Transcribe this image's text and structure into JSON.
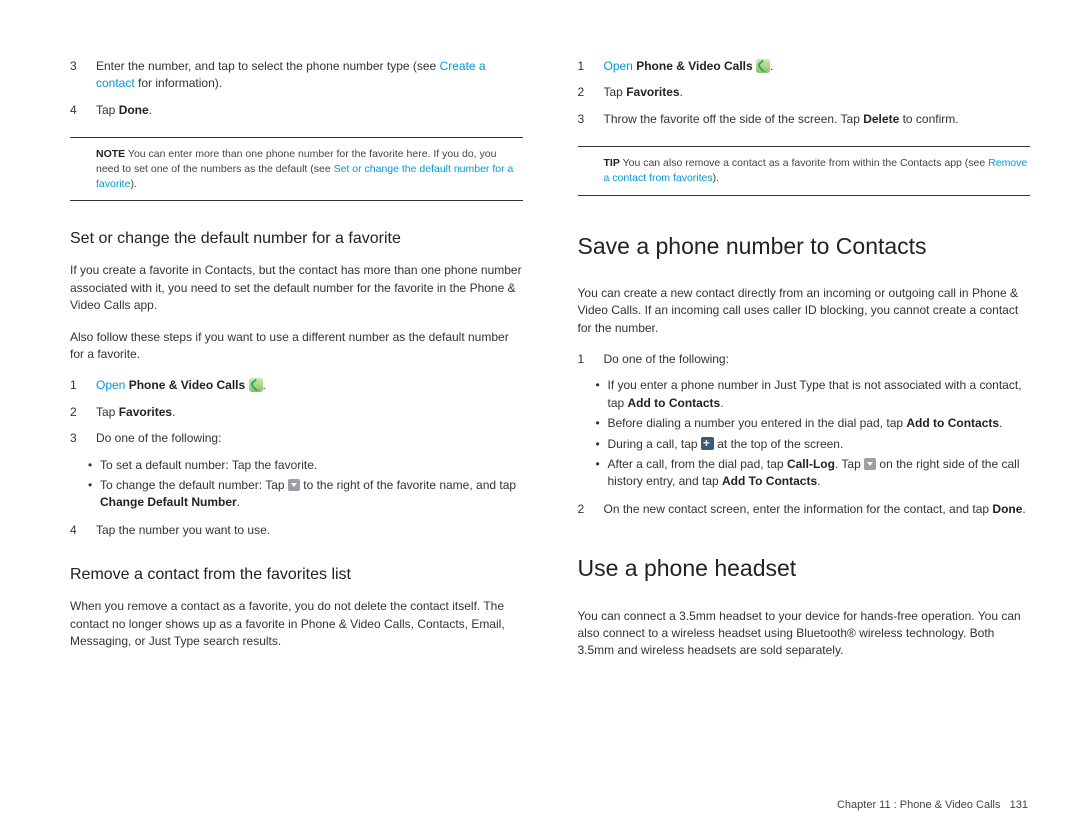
{
  "left": {
    "step3": {
      "n": "3",
      "t1": "Enter the number, and tap to select the phone number type (see ",
      "link": "Create a contact",
      "t2": " for information)."
    },
    "step4": {
      "n": "4",
      "t1": "Tap ",
      "b": "Done",
      "t2": "."
    },
    "note": {
      "label": "NOTE",
      "t1": "  You can enter more than one phone number for the favorite here. If you do, you need to set one of the numbers as the default (see ",
      "link": "Set or change the default number for a favorite",
      "t2": ")."
    },
    "h_set": "Set or change the default number for a favorite",
    "p_set1": "If you create a favorite in Contacts, but the contact has more than one phone number associated with it, you need to set the default number for the favorite in the Phone & Video Calls app.",
    "p_set2": "Also follow these steps if you want to use a different number as the default number for a favorite.",
    "s1": {
      "n": "1",
      "link": "Open",
      "b": " Phone & Video Calls ",
      "dot": "."
    },
    "s2": {
      "n": "2",
      "t1": "Tap ",
      "b": "Favorites",
      "t2": "."
    },
    "s3": {
      "n": "3",
      "t": "Do one of the following:"
    },
    "bul1": "To set a default number: Tap the favorite.",
    "bul2a": "To change the default number: Tap ",
    "bul2b": " to the right of the favorite name, and tap ",
    "bul2c": "Change Default Number",
    "bul2d": ".",
    "s4": {
      "n": "4",
      "t": "Tap the number you want to use."
    },
    "h_rem": "Remove a contact from the favorites list",
    "p_rem": "When you remove a contact as a favorite, you do not delete the contact itself. The contact no longer shows up as a favorite in Phone & Video Calls, Contacts, Email, Messaging, or Just Type search results."
  },
  "right": {
    "s1": {
      "n": "1",
      "link": "Open",
      "b": " Phone & Video Calls ",
      "dot": "."
    },
    "s2": {
      "n": "2",
      "t1": "Tap ",
      "b": "Favorites",
      "t2": "."
    },
    "s3": {
      "n": "3",
      "t1": "Throw the favorite off the side of the screen. Tap ",
      "b": "Delete",
      "t2": " to confirm."
    },
    "tip": {
      "label": "TIP",
      "t1": "  You can also remove a contact as a favorite from within the Contacts app (see ",
      "link": "Remove a contact from favorites",
      "t2": ")."
    },
    "h_save": "Save a phone number to Contacts",
    "p_save": "You can create a new contact directly from an incoming or outgoing call in Phone & Video Calls. If an incoming call uses caller ID blocking, you cannot create a contact for the number.",
    "ss1": {
      "n": "1",
      "t": "Do one of the following:"
    },
    "bul1a": "If you enter a phone number in Just Type that is not associated with a contact, tap ",
    "bul1b": "Add to Contacts",
    "bul1c": ".",
    "bul2a": "Before dialing a number you entered in the dial pad, tap ",
    "bul2b": "Add to Contacts",
    "bul2c": ".",
    "bul3a": "During a call, tap ",
    "bul3b": " at the top of the screen.",
    "bul4a": "After a call, from the dial pad, tap ",
    "bul4b": "Call-Log",
    "bul4c": ". Tap ",
    "bul4d": " on the right side of the call history entry, and tap ",
    "bul4e": "Add To Contacts",
    "bul4f": ".",
    "ss2": {
      "n": "2",
      "t1": "On the new contact screen, enter the information for the contact, and tap ",
      "b": "Done",
      "t2": "."
    },
    "h_head": "Use a phone headset",
    "p_head": "You can connect a 3.5mm headset to your device for hands-free operation. You can also connect to a wireless headset using Bluetooth® wireless technology. Both 3.5mm and wireless headsets are sold separately."
  },
  "footer": {
    "t1": "Chapter 11 : Phone & Video Calls",
    "page": "131"
  }
}
